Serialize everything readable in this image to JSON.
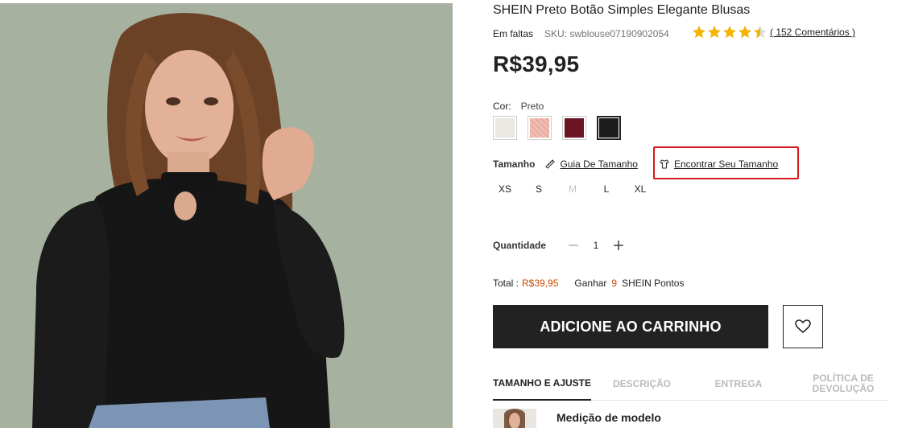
{
  "product": {
    "title": "SHEIN Preto Botão Simples Elegante Blusas",
    "stock_status": "Em faltas",
    "sku": "SKU: swblouse07190902054",
    "rating": 4.5,
    "reviews_label": "( 152 Comentários )",
    "price": "R$39,95"
  },
  "color": {
    "label": "Cor:",
    "selected": "Preto",
    "swatches": [
      {
        "name": "branco",
        "hex": "#ebe7e1"
      },
      {
        "name": "rosa",
        "hex": "#e9aea3"
      },
      {
        "name": "vinho",
        "hex": "#6b1524"
      },
      {
        "name": "preto",
        "hex": "#1c1c1c",
        "selected": true
      }
    ]
  },
  "size": {
    "label": "Tamanho",
    "guide_link": "Guia De Tamanho",
    "find_link": "Encontrar Seu Tamanho",
    "options": [
      {
        "label": "XS",
        "available": true
      },
      {
        "label": "S",
        "available": true
      },
      {
        "label": "M",
        "available": false
      },
      {
        "label": "L",
        "available": true
      },
      {
        "label": "XL",
        "available": true
      }
    ]
  },
  "quantity": {
    "label": "Quantidade",
    "value": "1"
  },
  "totals": {
    "total_label": "Total :",
    "total_value": "R$39,95",
    "earn_label": "Ganhar",
    "points": "9",
    "points_label": "SHEIN Pontos"
  },
  "actions": {
    "add_to_cart": "ADICIONE AO CARRINHO"
  },
  "tabs": [
    {
      "label": "TAMANHO E AJUSTE",
      "active": true
    },
    {
      "label": "DESCRIÇÃO",
      "active": false
    },
    {
      "label": "ENTREGA",
      "active": false
    },
    {
      "label": "POLÍTICA DE DEVOLUÇÃO",
      "active": false
    }
  ],
  "model": {
    "label": "Medição de modelo"
  },
  "colors": {
    "accent_price": "#c44a01",
    "highlight_box": "#d6191a",
    "button_bg": "#222222",
    "star": "#f4b400"
  },
  "icons": [
    "star-icon",
    "ruler-icon",
    "tshirt-icon",
    "minus-icon",
    "plus-icon",
    "heart-icon"
  ]
}
